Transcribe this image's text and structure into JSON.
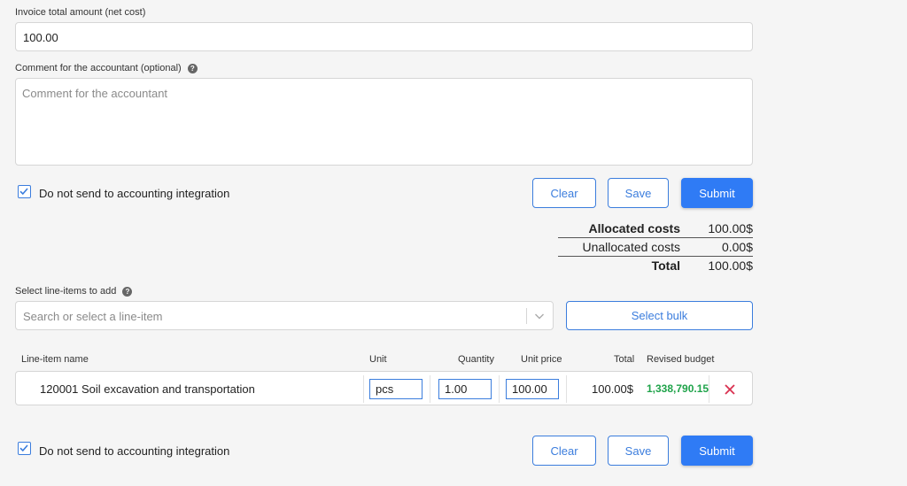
{
  "invoice": {
    "total_label": "Invoice total amount (net cost)",
    "total_value": "100.00",
    "comment_label": "Comment for the accountant (optional)",
    "comment_placeholder": "Comment for the accountant",
    "help_glyph": "?"
  },
  "actions_top": {
    "checkbox_label": "Do not send to accounting integration",
    "checked": true,
    "clear_label": "Clear",
    "save_label": "Save",
    "submit_label": "Submit"
  },
  "summary": {
    "allocated_label": "Allocated costs",
    "allocated_value": "100.00$",
    "unallocated_label": "Unallocated costs",
    "unallocated_value": "0.00$",
    "total_label": "Total",
    "total_value": "100.00$"
  },
  "line_items": {
    "select_label": "Select line-items to add",
    "search_placeholder": "Search or select a line-item",
    "select_bulk_label": "Select bulk",
    "columns": {
      "name": "Line-item name",
      "unit": "Unit",
      "quantity": "Quantity",
      "unit_price": "Unit price",
      "total": "Total",
      "revised_budget": "Revised budget"
    },
    "rows": [
      {
        "name": "120001 Soil excavation and transportation",
        "unit": "pcs",
        "quantity": "1.00",
        "unit_price": "100.00",
        "total": "100.00$",
        "revised_budget": "1,338,790.15"
      }
    ]
  },
  "actions_bottom": {
    "checkbox_label": "Do not send to accounting integration",
    "checked": true,
    "clear_label": "Clear",
    "save_label": "Save",
    "submit_label": "Submit"
  },
  "colors": {
    "accent": "#2f7bf5",
    "budget_positive": "#1fa34a",
    "remove": "#d9304f"
  },
  "icons": {
    "help": "question-circle-icon",
    "checkbox": "checkmark-icon",
    "dropdown": "chevron-down-icon",
    "remove": "close-icon"
  }
}
